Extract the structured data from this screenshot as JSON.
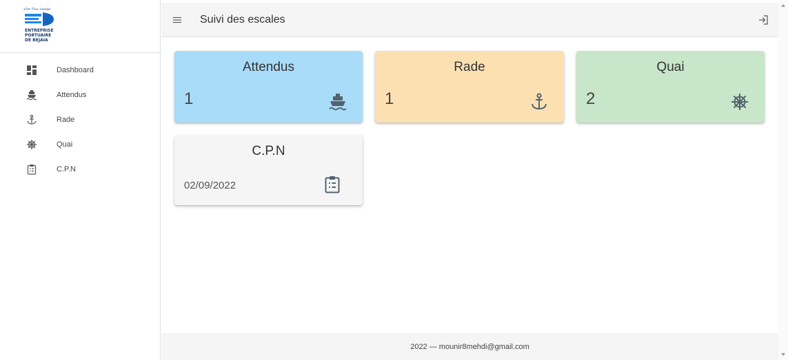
{
  "logo": {
    "arabic_text": "مؤسسة ميناء بجاية",
    "lines": [
      "ENTREPRISE",
      "PORTUAIRE",
      "DE BEJAIA"
    ]
  },
  "sidebar": {
    "items": [
      {
        "label": "Dashboard",
        "icon": "dashboard-icon"
      },
      {
        "label": "Attendus",
        "icon": "ship-icon"
      },
      {
        "label": "Rade",
        "icon": "anchor-icon"
      },
      {
        "label": "Quai",
        "icon": "ship-wheel-icon"
      },
      {
        "label": "C.P.N",
        "icon": "clipboard-list-icon"
      }
    ]
  },
  "header": {
    "title": "Suivi des escales",
    "menu_icon": "menu-icon",
    "logout_icon": "logout-icon"
  },
  "cards": {
    "attendus": {
      "title": "Attendus",
      "value": "1",
      "icon": "ship-icon",
      "color": "#a8dcf8"
    },
    "rade": {
      "title": "Rade",
      "value": "1",
      "icon": "anchor-icon",
      "color": "#fde0b2"
    },
    "quai": {
      "title": "Quai",
      "value": "2",
      "icon": "ship-wheel-icon",
      "color": "#c8e6c9"
    },
    "cpn": {
      "title": "C.P.N",
      "date": "02/09/2022",
      "icon": "clipboard-list-icon",
      "color": "#f5f5f5"
    }
  },
  "footer": {
    "text": "2022 — mounir8mehdi@gmail.com"
  }
}
